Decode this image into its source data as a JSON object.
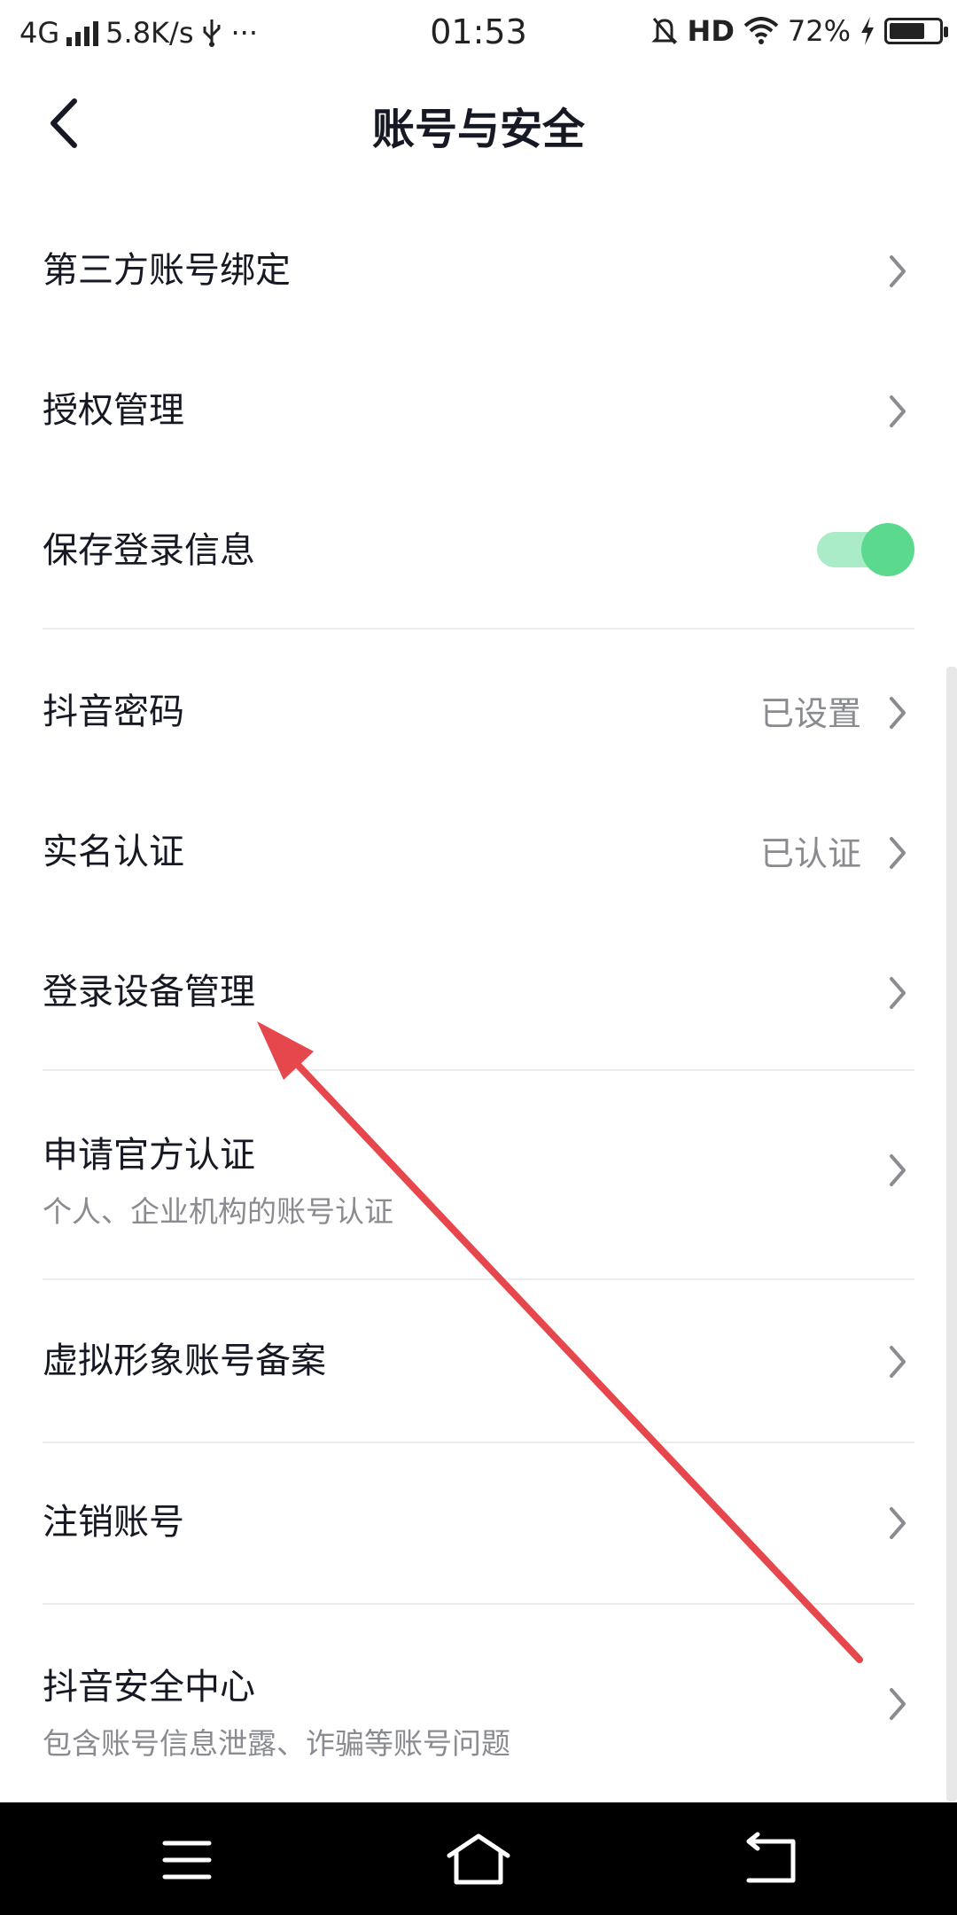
{
  "status_bar": {
    "network": "4G",
    "speed": "5.8K/s",
    "extra": "···",
    "time": "01:53",
    "hd": "HD",
    "battery_text": "72%",
    "battery_level": 0.72,
    "icons": [
      "signal-icon",
      "usb-icon",
      "mute-bell-icon",
      "wifi-icon",
      "charging-icon",
      "battery-icon"
    ]
  },
  "header": {
    "title": "账号与安全",
    "back_icon": "chevron-left-icon"
  },
  "settings": {
    "third_party": {
      "label": "第三方账号绑定"
    },
    "authorization": {
      "label": "授权管理"
    },
    "save_login": {
      "label": "保存登录信息",
      "enabled": true
    },
    "password": {
      "label": "抖音密码",
      "value": "已设置"
    },
    "real_name": {
      "label": "实名认证",
      "value": "已认证"
    },
    "devices": {
      "label": "登录设备管理"
    },
    "official_verify": {
      "label": "申请官方认证",
      "sub": "个人、企业机构的账号认证"
    },
    "virtual_avatar": {
      "label": "虚拟形象账号备案"
    },
    "deactivate": {
      "label": "注销账号"
    },
    "security_center": {
      "label": "抖音安全中心",
      "sub": "包含账号信息泄露、诈骗等账号问题"
    }
  },
  "colors": {
    "toggle_on": "#5ad98f",
    "toggle_track": "#a9ecc7",
    "annotation_arrow": "#e5474c",
    "secondary_text": "#8a8b91"
  },
  "system_nav": [
    "menu-icon",
    "home-icon",
    "back-icon"
  ]
}
